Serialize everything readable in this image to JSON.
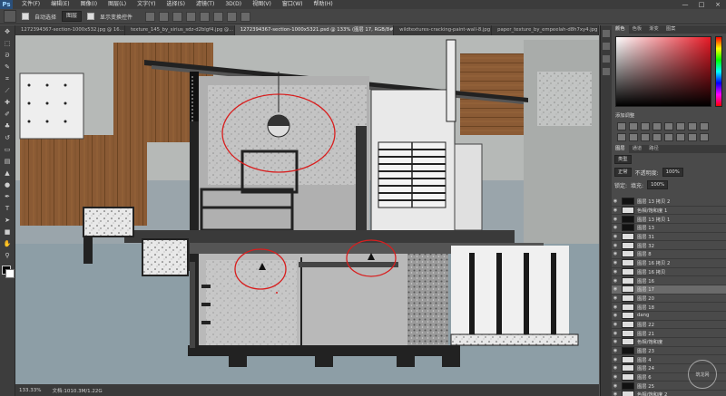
{
  "app": {
    "logo": "Ps"
  },
  "menubar": {
    "items": [
      "文件(F)",
      "编辑(E)",
      "图像(I)",
      "图层(L)",
      "文字(Y)",
      "选择(S)",
      "滤镜(T)",
      "3D(D)",
      "视图(V)",
      "窗口(W)",
      "帮助(H)"
    ]
  },
  "window": {
    "minimize": "—",
    "maximize": "□",
    "close": "×"
  },
  "options": {
    "auto_select_label": "自动选择",
    "auto_select_value": "图层",
    "show_transform_label": "显示变换控件"
  },
  "tabs": [
    {
      "label": "1272394367-section-1000x532.jpg @ 16...",
      "active": false
    },
    {
      "label": "texture_145_by_sirius_sdz-d2blgf4.jpg @...",
      "active": false
    },
    {
      "label": "1272394367-section-1000x5321.psd @ 133% (图层 17, RGB/8#)",
      "active": true
    },
    {
      "label": "wildtextures-cracking-paint-wall-8.jpg",
      "active": false
    },
    {
      "label": "paper_texture_by_empeelah-d8h7xy4.jpg",
      "active": false
    }
  ],
  "status": {
    "zoom": "133.33%",
    "doc": "文档:1010.3M/1.22G"
  },
  "panels": {
    "color_tabs": [
      "颜色",
      "色板",
      "渐变",
      "图案"
    ],
    "adjust_title": "添加调整",
    "layer_tabs": [
      "图层",
      "通道",
      "路径"
    ],
    "filter_kind": "类型",
    "blend_mode": "正常",
    "opacity_label": "不透明度:",
    "opacity_value": "100%",
    "lock_label": "锁定:",
    "fill_label": "填充:",
    "fill_value": "100%"
  },
  "layers": [
    {
      "name": "图层 13 拷贝 2",
      "dark": true
    },
    {
      "name": "色相/饱和度 1",
      "dark": false
    },
    {
      "name": "图层 13 拷贝 1",
      "dark": true
    },
    {
      "name": "图层 13",
      "dark": true
    },
    {
      "name": "图层 31",
      "dark": false
    },
    {
      "name": "图层 32",
      "dark": false
    },
    {
      "name": "图层 8",
      "dark": false
    },
    {
      "name": "图层 16 拷贝 2",
      "dark": false
    },
    {
      "name": "图层 16 拷贝",
      "dark": false
    },
    {
      "name": "图层 16",
      "dark": false
    },
    {
      "name": "图层 17",
      "dark": false,
      "selected": true
    },
    {
      "name": "图层 20",
      "dark": false
    },
    {
      "name": "图层 18",
      "dark": false
    },
    {
      "name": "dang",
      "dark": false
    },
    {
      "name": "图层 22",
      "dark": false
    },
    {
      "name": "图层 21",
      "dark": false
    },
    {
      "name": "色相/饱和度",
      "dark": false
    },
    {
      "name": "图层 23",
      "dark": true
    },
    {
      "name": "图层 4",
      "dark": false
    },
    {
      "name": "图层 24",
      "dark": false
    },
    {
      "name": "图层 6",
      "dark": false
    },
    {
      "name": "图层 25",
      "dark": true
    },
    {
      "name": "色相/饱和度 2",
      "dark": false
    }
  ],
  "watermark": "筑龙网"
}
